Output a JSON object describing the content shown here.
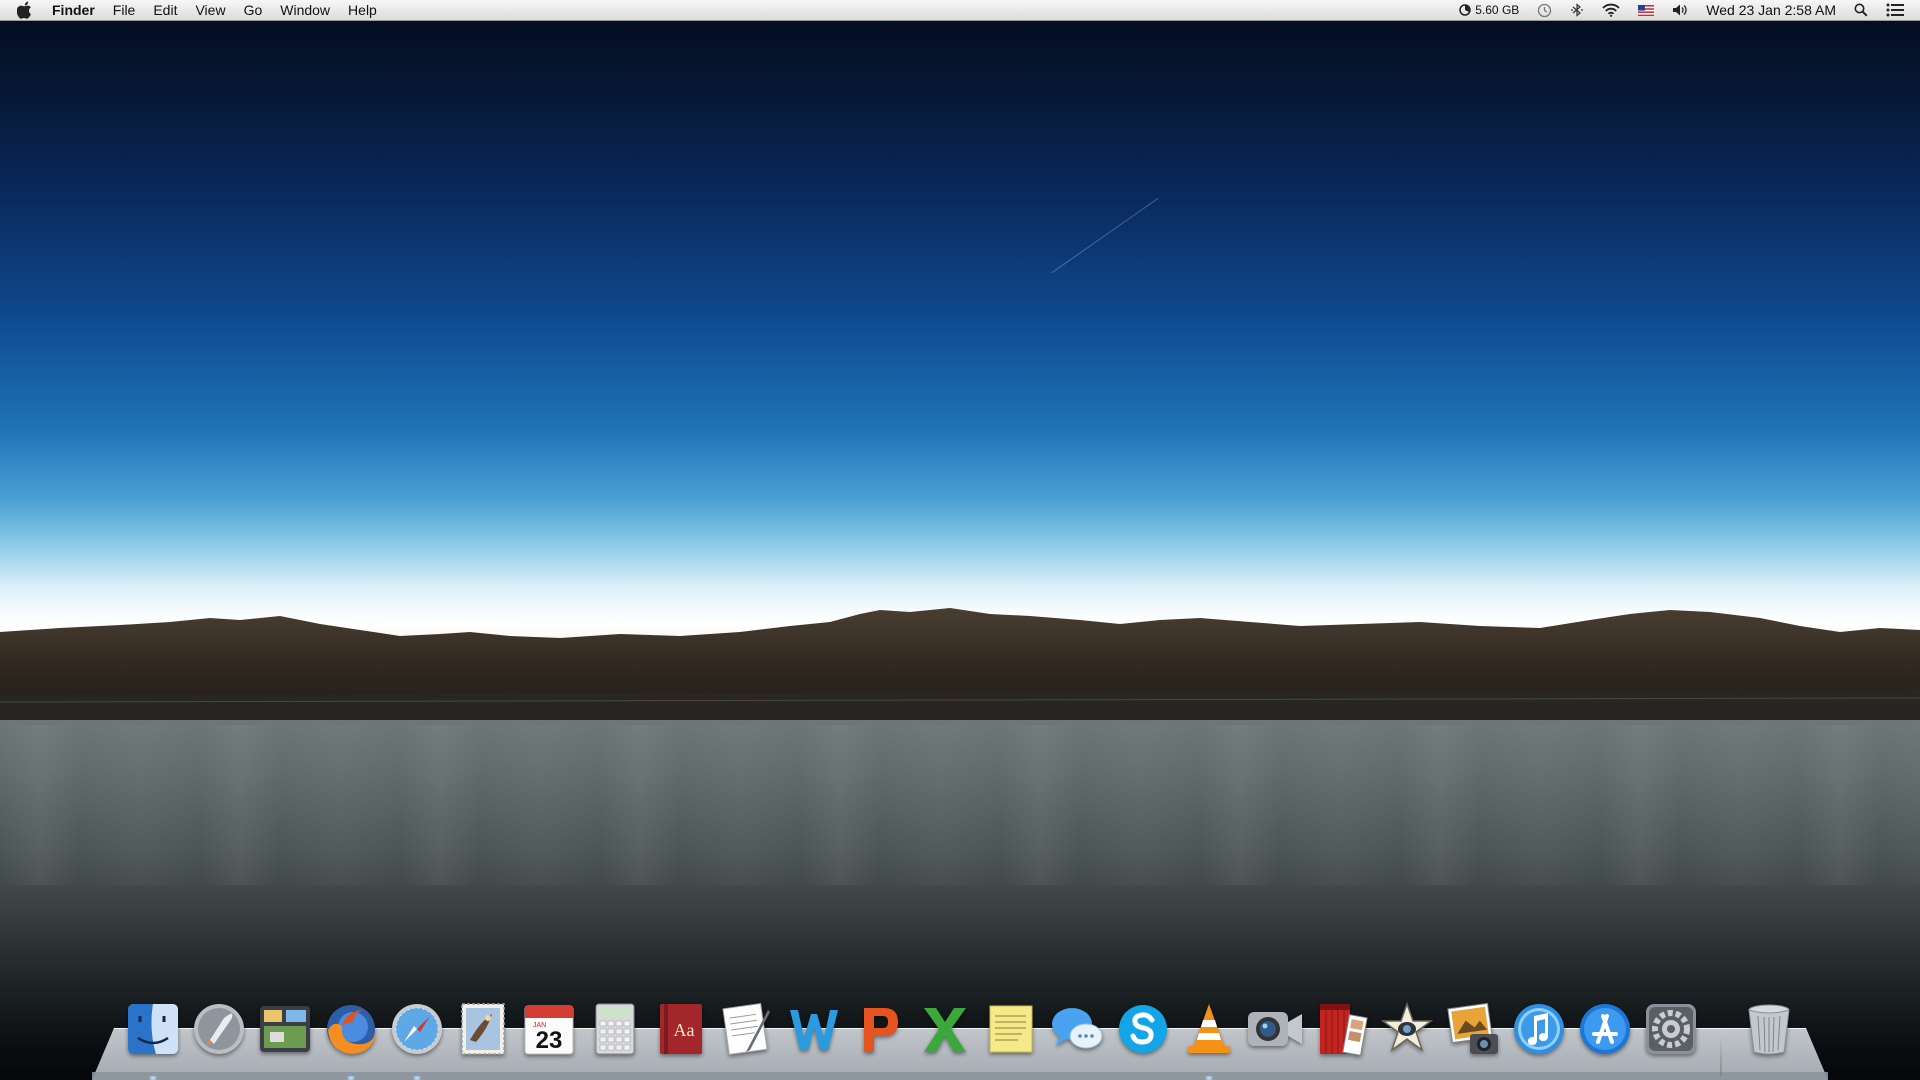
{
  "menubar": {
    "app_name": "Finder",
    "menus": [
      "File",
      "Edit",
      "View",
      "Go",
      "Window",
      "Help"
    ],
    "status": {
      "memory_label": "5.60 GB",
      "clock": "Wed 23 Jan  2:58 AM",
      "icons": [
        "memory-gauge-icon",
        "time-machine-icon",
        "bluetooth-icon",
        "wifi-icon",
        "us-flag-input-icon",
        "volume-icon",
        "spotlight-icon",
        "notification-center-icon"
      ]
    }
  },
  "dock": {
    "calendar_month": "JAN",
    "calendar_day": "23",
    "dictionary_label": "Aa",
    "apps": [
      "finder",
      "launchpad",
      "mission-control",
      "firefox",
      "safari",
      "mail",
      "calendar",
      "calculator",
      "dictionary",
      "textedit",
      "word",
      "powerpoint",
      "excel",
      "stickies",
      "messages",
      "skype",
      "vlc",
      "facetime",
      "photo-booth",
      "imovie",
      "iphoto",
      "itunes",
      "app-store",
      "system-preferences",
      "trash"
    ]
  },
  "colors": {
    "sky_top": "#040b1c",
    "sky_mid": "#1f74b8",
    "horizon": "#ffffff",
    "mountains": "#3a3128",
    "lake": "#5e6969"
  }
}
